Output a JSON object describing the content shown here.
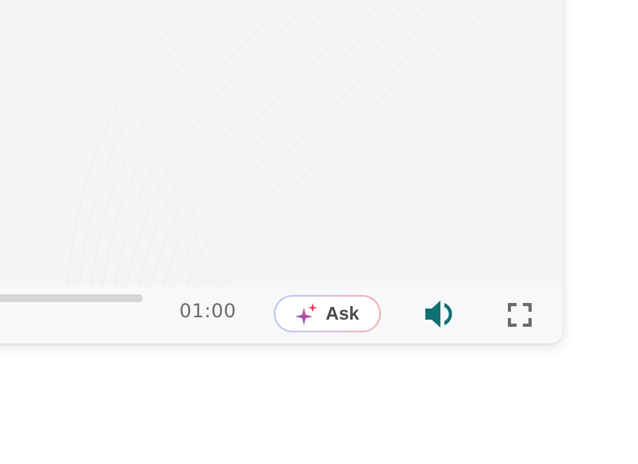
{
  "player": {
    "time": "01:00",
    "ask_label": "Ask",
    "progress_fraction": 0.0
  },
  "icons": {
    "sparkle": "sparkle-icon",
    "volume": "volume-icon",
    "fullscreen": "fullscreen-icon"
  },
  "colors": {
    "volume_icon": "#0f7172",
    "fullscreen_icon": "#6b6b6b",
    "sparkle_gradient_start": "#5a6fd8",
    "sparkle_gradient_end": "#e0405a"
  }
}
